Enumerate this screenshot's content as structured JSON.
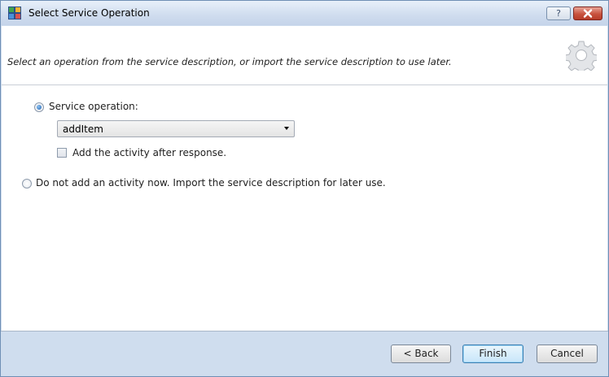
{
  "window": {
    "title": "Select Service Operation",
    "help_label": "?"
  },
  "header": {
    "instruction": "Select an operation from the service description, or import the service description to use later."
  },
  "options": {
    "service_operation_label": "Service operation:",
    "service_operation_selected": true,
    "operation_value": "addItem",
    "after_response_label": "Add the activity after response.",
    "after_response_checked": false,
    "import_later_label": "Do not add an activity now. Import the service description for later use.",
    "import_later_selected": false
  },
  "footer": {
    "back_label": "< Back",
    "finish_label": "Finish",
    "cancel_label": "Cancel"
  },
  "icons": {
    "app": "app-icon",
    "gear": "gear-icon",
    "close": "close-icon",
    "dropdown": "chevron-down-icon"
  },
  "colors": {
    "titlebar": "#cfdcee",
    "close_button": "#c8523e",
    "default_button": "#c8e6fa",
    "radio_selected": "#1f63b4"
  }
}
